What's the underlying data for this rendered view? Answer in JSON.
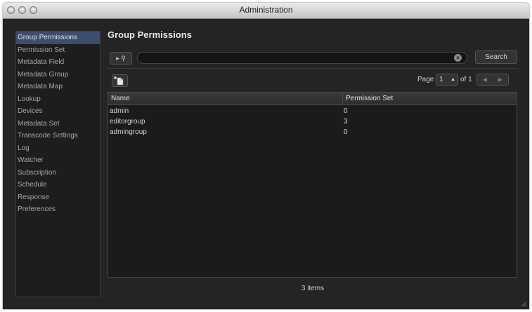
{
  "window": {
    "title": "Administration"
  },
  "sidebar": {
    "items": [
      {
        "label": "Group Permissions",
        "active": true
      },
      {
        "label": "Permission Set"
      },
      {
        "label": "Metadata Field"
      },
      {
        "label": "Metadata Group"
      },
      {
        "label": "Metadata Map"
      },
      {
        "label": "Lookup"
      },
      {
        "label": "Devices"
      },
      {
        "label": "Metadata Set"
      },
      {
        "label": "Transcode Settings"
      },
      {
        "label": "Log"
      },
      {
        "label": "Watcher"
      },
      {
        "label": "Subscription"
      },
      {
        "label": "Schedule"
      },
      {
        "label": "Response"
      },
      {
        "label": "Preferences"
      }
    ]
  },
  "main": {
    "heading": "Group Permissions",
    "search": {
      "scope_icon": "search-scope-icon",
      "value": "",
      "button_label": "Search"
    },
    "pager": {
      "page_label": "Page",
      "current_page": "1",
      "of_label": "of 1"
    },
    "table": {
      "columns": [
        "Name",
        "Permission Set"
      ],
      "rows": [
        [
          "admin",
          "0"
        ],
        [
          "editorgroup",
          "3"
        ],
        [
          "admingroup",
          "0"
        ]
      ]
    },
    "item_count": "3 items"
  },
  "colors": {
    "background": "#242424",
    "selection": "#3c4d6d",
    "text": "#d4d4d4"
  }
}
